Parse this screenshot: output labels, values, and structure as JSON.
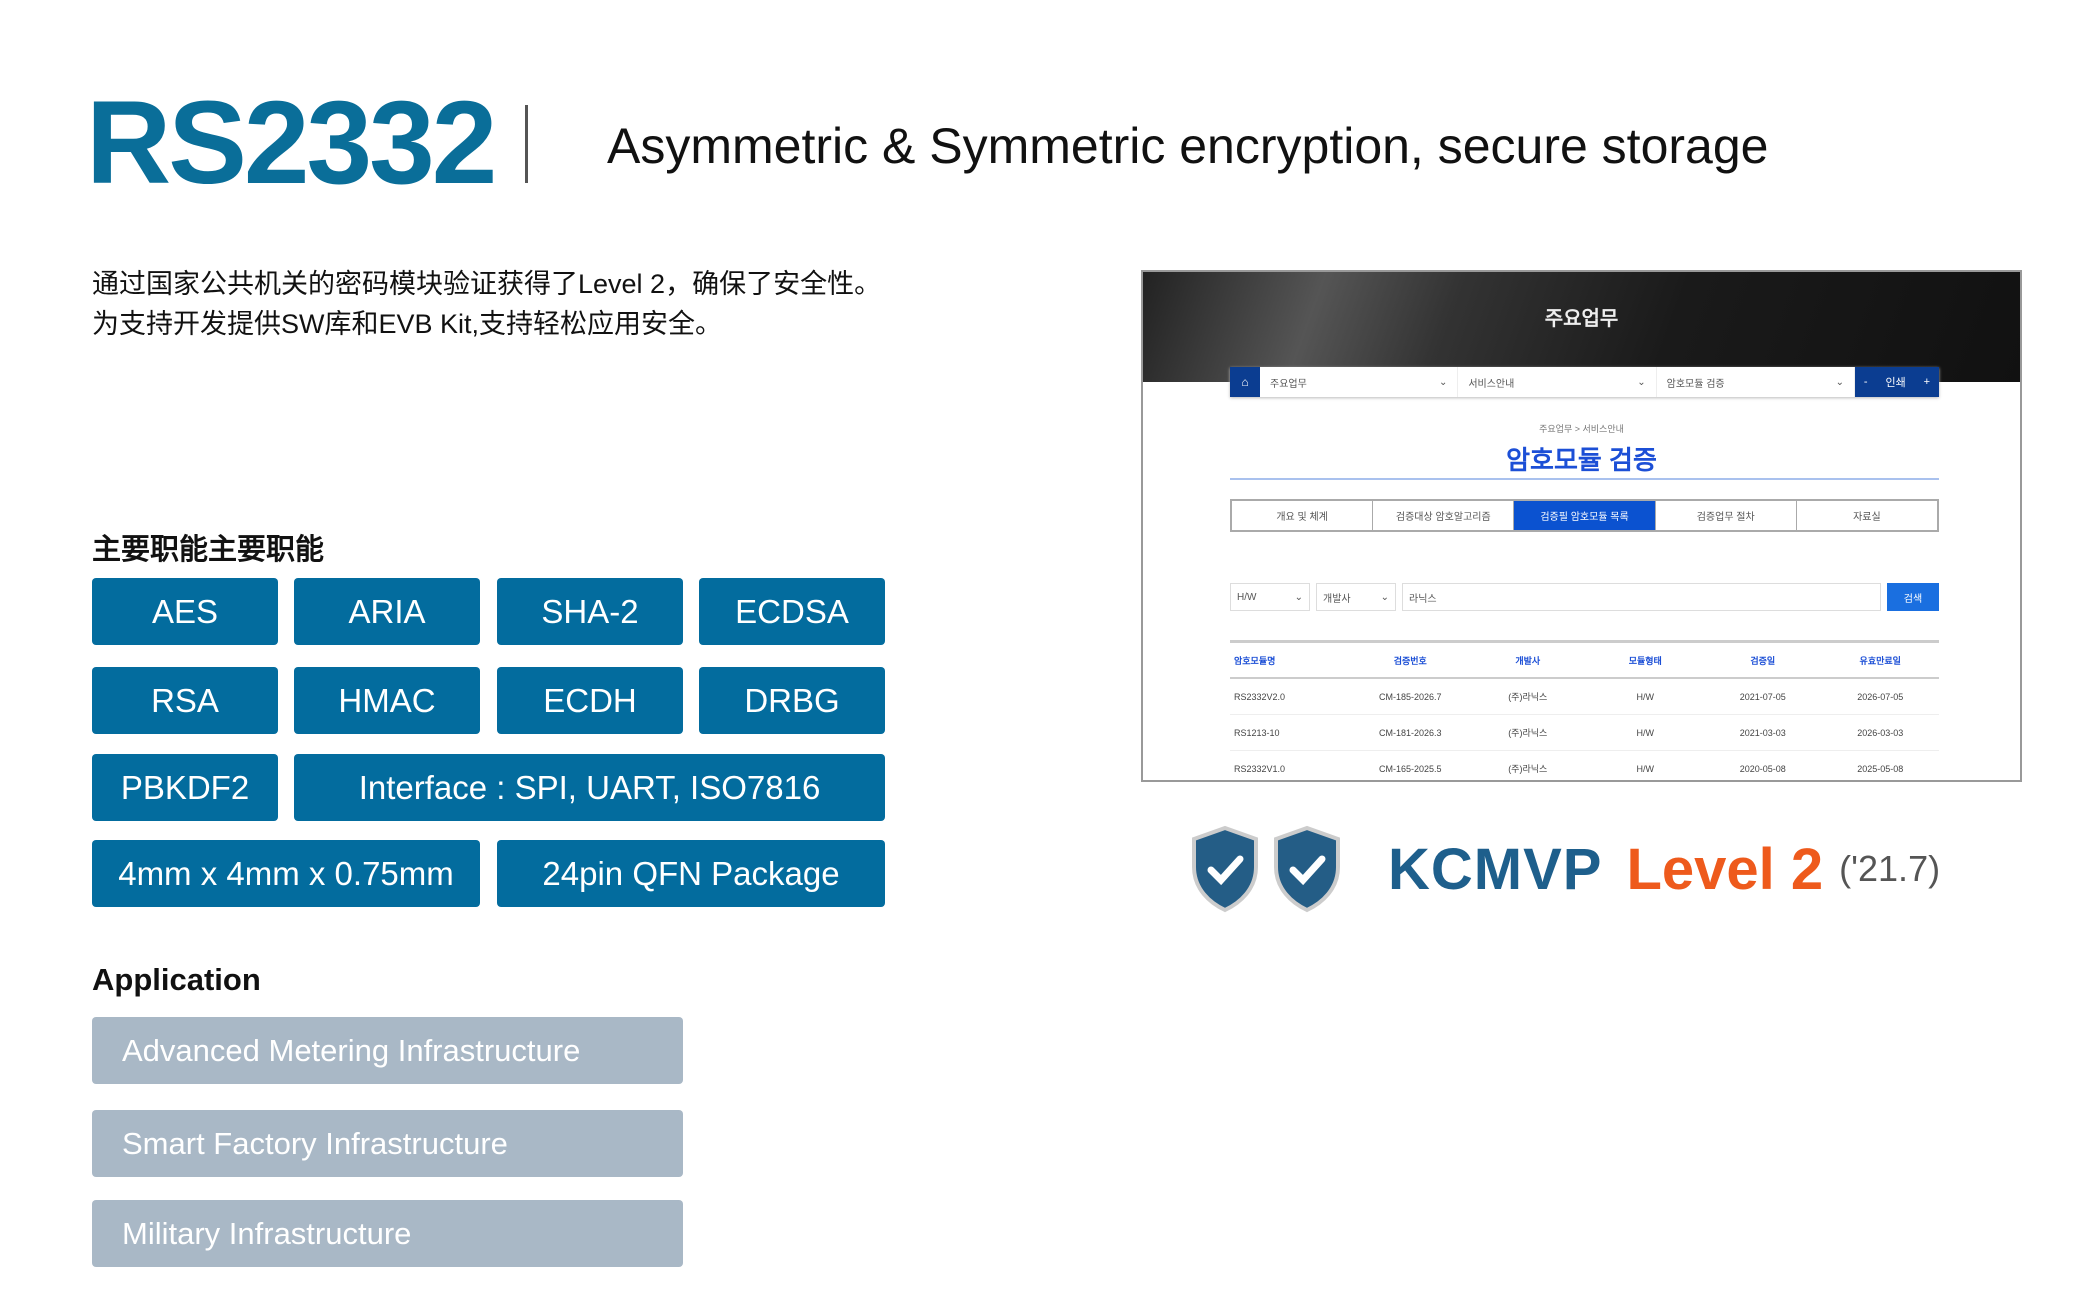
{
  "header": {
    "model": "RS2332",
    "subtitle": "Asymmetric & Symmetric encryption, secure storage"
  },
  "description": [
    "通过国家公共机关的密码模块验证获得了Level 2，确保了安全性。",
    "为支持开发提供SW库和EVB Kit,支持轻松应用安全。"
  ],
  "features": {
    "heading": "主要职能主要职能",
    "items": [
      "AES",
      "ARIA",
      "SHA-2",
      "ECDSA",
      "RSA",
      "HMAC",
      "ECDH",
      "DRBG",
      "PBKDF2",
      "Interface : SPI, UART, ISO7816",
      "4mm x 4mm x 0.75mm",
      "24pin QFN Package"
    ]
  },
  "application": {
    "heading": "Application",
    "items": [
      "Advanced Metering Infrastructure",
      "Smart Factory Infrastructure",
      "Military Infrastructure"
    ]
  },
  "screenshot": {
    "banner_title": "주요업무",
    "nav": [
      "주요업무",
      "서비스안내",
      "암호모듈 검증"
    ],
    "nav_actions": [
      "-",
      "인쇄",
      "+"
    ],
    "breadcrumb": "주요업무 > 서비스안내",
    "title": "암호모듈 검증",
    "tabs": [
      "개요 및 체계",
      "검증대상 암호알고리즘",
      "검증필 암호모듈 목록",
      "검증업무 절차",
      "자료실"
    ],
    "active_tab": 2,
    "search": {
      "type": "H/W",
      "field": "개발사",
      "query": "라닉스",
      "button": "검색"
    },
    "columns": [
      "암호모듈명",
      "검증번호",
      "개발사",
      "모듈형태",
      "검증일",
      "유효만료일"
    ],
    "rows": [
      [
        "RS2332V2.0",
        "CM-185-2026.7",
        "(주)라닉스",
        "H/W",
        "2021-07-05",
        "2026-07-05"
      ],
      [
        "RS1213-10",
        "CM-181-2026.3",
        "(주)라닉스",
        "H/W",
        "2021-03-03",
        "2026-03-03"
      ],
      [
        "RS2332V1.0",
        "CM-165-2025.5",
        "(주)라닉스",
        "H/W",
        "2020-05-08",
        "2025-05-08"
      ]
    ]
  },
  "certification": {
    "name": "KCMVP",
    "level": "Level 2",
    "date": "('21.7)",
    "colors": {
      "name": "#1e5f8c",
      "level": "#ee5a1c",
      "shield": "#245d86"
    }
  },
  "colors": {
    "accent": "#036c9e",
    "title": "#0a6e99",
    "application": "#a9b8c6"
  }
}
